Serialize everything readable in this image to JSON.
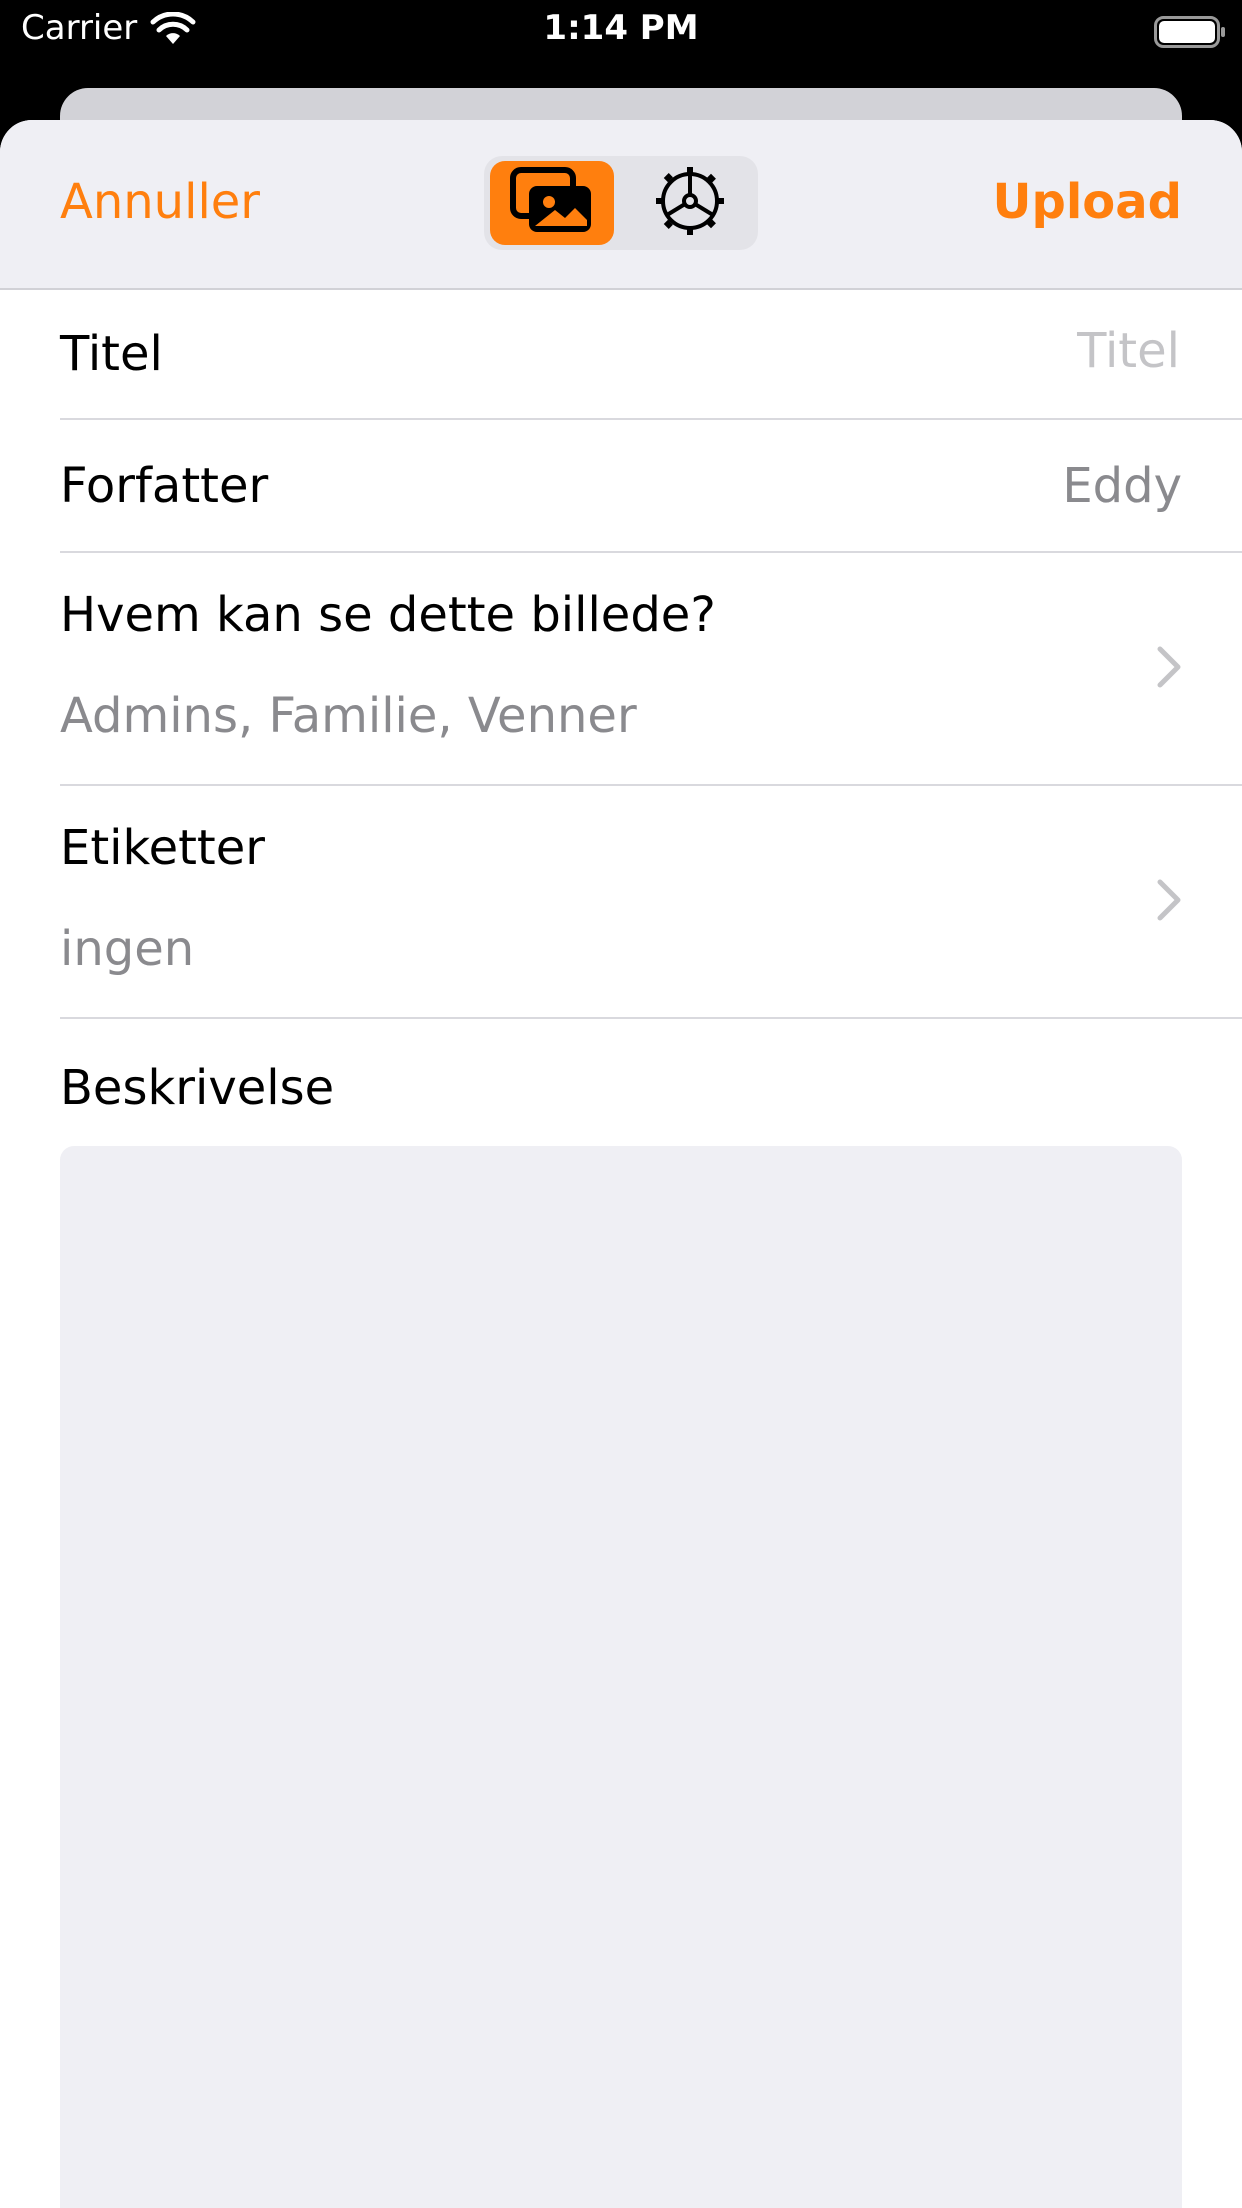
{
  "status_bar": {
    "carrier": "Carrier",
    "time": "1:14 PM"
  },
  "navbar": {
    "cancel_label": "Annuller",
    "upload_label": "Upload",
    "accent_color": "#ff7f0e",
    "segments": [
      {
        "icon": "photos-icon",
        "selected": true
      },
      {
        "icon": "gear-icon",
        "selected": false
      }
    ]
  },
  "form": {
    "title": {
      "label": "Titel",
      "value": "",
      "placeholder": "Titel"
    },
    "author": {
      "label": "Forfatter",
      "value": "Eddy"
    },
    "privacy": {
      "label": "Hvem kan se dette billede?",
      "value": "Admins, Familie, Venner"
    },
    "tags": {
      "label": "Etiketter",
      "value": "ingen"
    },
    "description": {
      "label": "Beskrivelse",
      "value": ""
    }
  }
}
